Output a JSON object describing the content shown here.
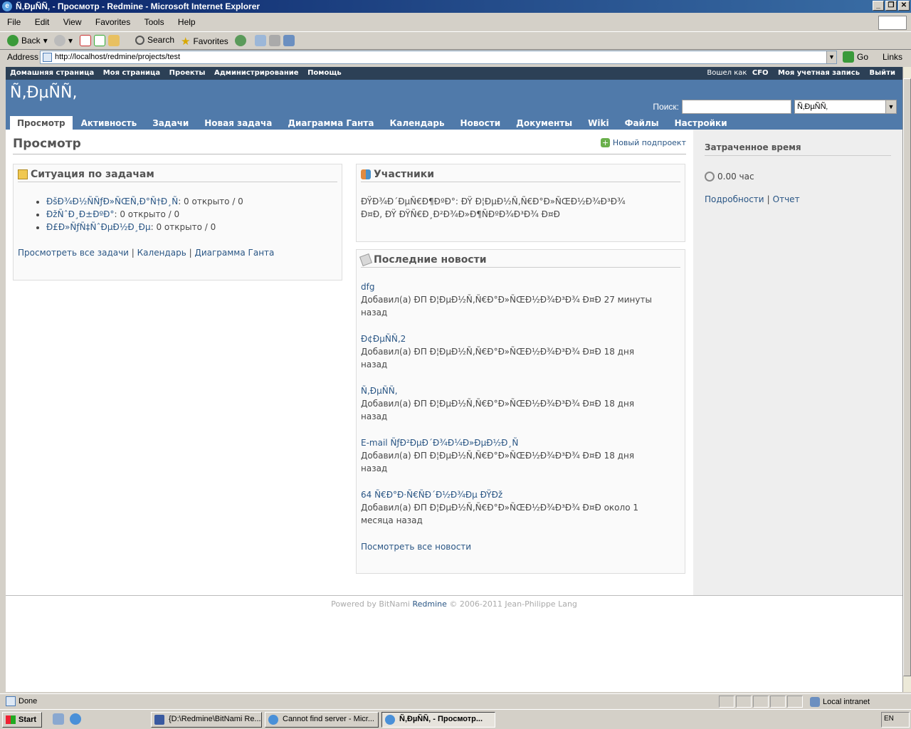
{
  "window": {
    "title": "Ñ‚ÐµÑÑ‚ - Просмотр - Redmine - Microsoft Internet Explorer"
  },
  "menu": [
    "File",
    "Edit",
    "View",
    "Favorites",
    "Tools",
    "Help"
  ],
  "toolbar": {
    "back": "Back",
    "search": "Search",
    "favorites": "Favorites"
  },
  "address": {
    "label": "Address",
    "url": "http://localhost/redmine/projects/test",
    "go": "Go",
    "links": "Links"
  },
  "topmenu": {
    "left": [
      "Домашняя страница",
      "Моя страница",
      "Проекты",
      "Администрирование",
      "Помощь"
    ],
    "logged_as": "Вошел как",
    "user": "CFO",
    "account": "Моя учетная запись",
    "logout": "Выйти"
  },
  "header": {
    "project_title": "Ñ‚ÐµÑÑ‚",
    "search_label": "Поиск:",
    "project_select": "Ñ‚ÐµÑÑ‚"
  },
  "tabs": [
    "Просмотр",
    "Активность",
    "Задачи",
    "Новая задача",
    "Диаграмма Ганта",
    "Календарь",
    "Новости",
    "Документы",
    "Wiki",
    "Файлы",
    "Настройки"
  ],
  "page": {
    "title": "Просмотр",
    "new_subproject": "Новый подпроект"
  },
  "issues_box": {
    "title": "Ситуация по задачам",
    "items": [
      {
        "name": "ÐšÐ¾Ð½ÑÑƒÐ»ÑŒÑ‚Ð°Ñ†Ð¸Ñ",
        "status": ": 0 открыто / 0"
      },
      {
        "name": "ÐžÑˆÐ¸Ð±ÐºÐ°",
        "status": ": 0 открыто / 0"
      },
      {
        "name": "Ð£Ð»ÑƒÑ‡ÑˆÐµÐ½Ð¸Ðµ",
        "status": ": 0 открыто / 0"
      }
    ],
    "links": [
      "Просмотреть все задачи",
      "Календарь",
      "Диаграмма Ганта"
    ]
  },
  "members_box": {
    "title": "Участники",
    "line1": "ÐŸÐ¾Ð´ÐµÑ€Ð¶ÐºÐ°: ÐŸ Ð¦ÐµÐ½Ñ‚Ñ€Ð°Ð»ÑŒÐ½Ð¾Ð³Ð¾",
    "line2": "Ð¤Ð, ÐŸ ÐŸÑ€Ð¸Ð²Ð¾Ð»Ð¶ÑÐºÐ¾Ð³Ð¾ Ð¤Ð"
  },
  "news_box": {
    "title": "Последние новости",
    "items": [
      {
        "title": "dfg",
        "line1": "Добавил(а) ÐП Ð¦ÐµÐ½Ñ‚Ñ€Ð°Ð»ÑŒÐ½Ð¾Ð³Ð¾ Ð¤Ð 27 минуты",
        "line2": "назад"
      },
      {
        "title": "Ð¢ÐµÑÑ‚2",
        "line1": "Добавил(а) ÐП Ð¦ÐµÐ½Ñ‚Ñ€Ð°Ð»ÑŒÐ½Ð¾Ð³Ð¾ Ð¤Ð 18 дня",
        "line2": "назад"
      },
      {
        "title": "Ñ‚ÐµÑÑ‚",
        "line1": "Добавил(а) ÐП Ð¦ÐµÐ½Ñ‚Ñ€Ð°Ð»ÑŒÐ½Ð¾Ð³Ð¾ Ð¤Ð 18 дня",
        "line2": "назад"
      },
      {
        "title": "E-mail ÑƒÐ²ÐµÐ´Ð¾Ð¼Ð»ÐµÐ½Ð¸Ñ",
        "line1": "Добавил(а) ÐП Ð¦ÐµÐ½Ñ‚Ñ€Ð°Ð»ÑŒÐ½Ð¾Ð³Ð¾ Ð¤Ð 18 дня",
        "line2": "назад"
      },
      {
        "title": "64 Ñ€Ð°Ð·Ñ€ÑÐ´Ð½Ð¾Ðµ ÐŸÐž",
        "line1": "Добавил(а) ÐП Ð¦ÐµÐ½Ñ‚Ñ€Ð°Ð»ÑŒÐ½Ð¾Ð³Ð¾ Ð¤Ð около 1",
        "line2": "месяца назад"
      }
    ],
    "all_link": "Посмотреть все новости"
  },
  "sidebar": {
    "title": "Затраченное время",
    "hours": "0.00 час",
    "details": "Подробности",
    "report": "Отчет"
  },
  "footer": {
    "powered": "Powered by BitNami",
    "redmine": "Redmine",
    "copyright": "© 2006-2011 Jean-Philippe Lang"
  },
  "status": {
    "text": "Done",
    "zone": "Local intranet"
  },
  "taskbar": {
    "start": "Start",
    "tasks": [
      "{D:\\Redmine\\BitNami Re...",
      "Cannot find server - Micr...",
      "Ñ‚ÐµÑÑ‚ - Просмотр..."
    ],
    "tray": "EN"
  }
}
